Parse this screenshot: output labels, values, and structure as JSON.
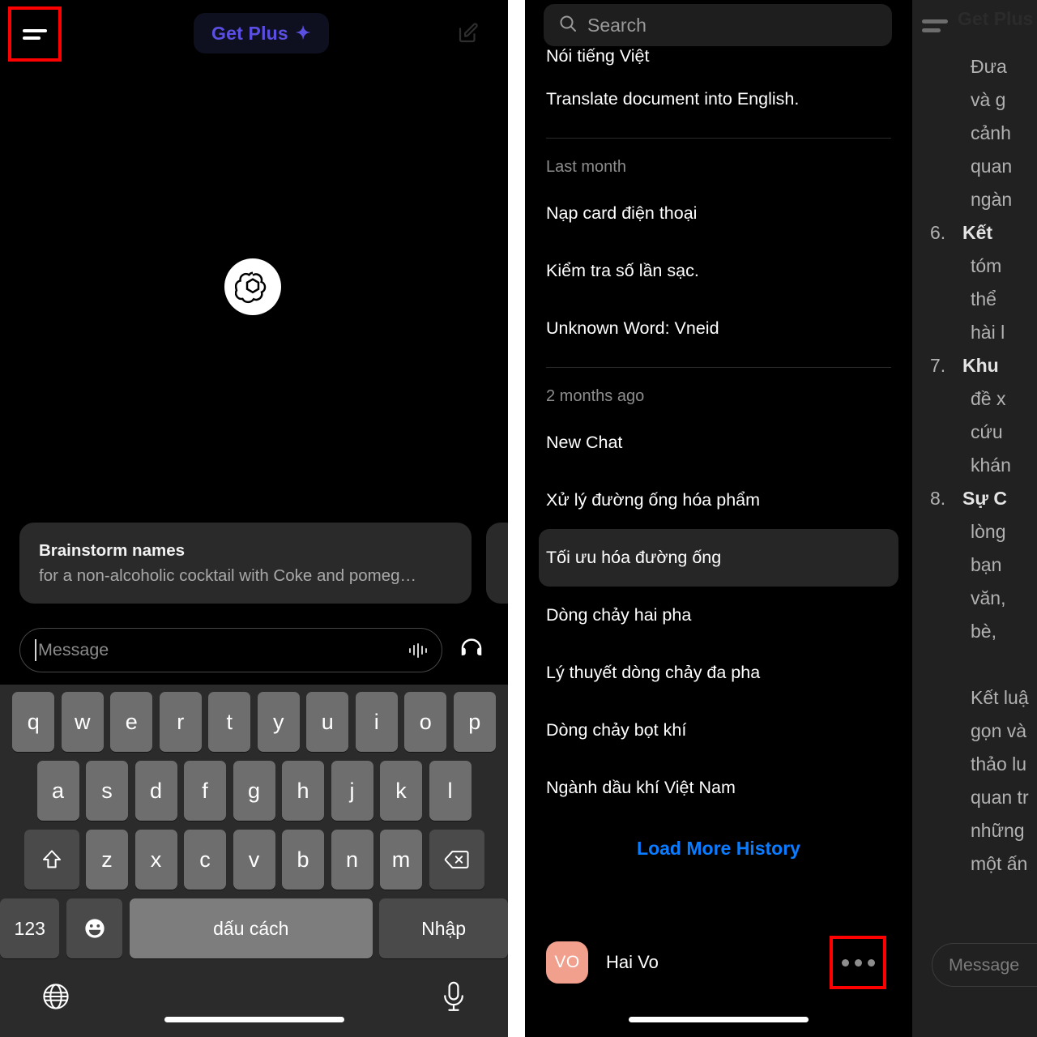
{
  "left_panel": {
    "header": {
      "menu_icon": "hamburger-menu-icon",
      "get_plus_label": "Get Plus",
      "get_plus_sparkle": "✦",
      "get_plus_text_color": "#5a4fe0",
      "get_plus_bg_color": "#0e1020",
      "new_chat_icon": "compose-edit-icon",
      "highlight_color": "#ff0000"
    },
    "brand_logo": "openai-logo",
    "suggestion_card": {
      "title": "Brainstorm names",
      "subtitle": "for a non-alcoholic cocktail with Coke and pomeg…"
    },
    "composer": {
      "placeholder": "Message",
      "waveform_icon": "audio-waveform-icon",
      "headset_icon": "headphones-icon"
    },
    "keyboard": {
      "row1": [
        "q",
        "w",
        "e",
        "r",
        "t",
        "y",
        "u",
        "i",
        "o",
        "p"
      ],
      "row2": [
        "a",
        "s",
        "d",
        "f",
        "g",
        "h",
        "j",
        "k",
        "l"
      ],
      "row3": [
        "z",
        "x",
        "c",
        "v",
        "b",
        "n",
        "m"
      ],
      "shift_icon": "shift-arrow-icon",
      "backspace_icon": "backspace-icon",
      "numbers_label": "123",
      "emoji_icon": "emoji-smiley-icon",
      "space_label": "dấu cách",
      "enter_label": "Nhập",
      "globe_icon": "globe-language-icon",
      "mic_icon": "microphone-icon"
    }
  },
  "mid_panel": {
    "search": {
      "placeholder": "Search",
      "icon": "search-icon"
    },
    "clipped_top_item": "Nói tiếng Việt",
    "top_items": [
      "Translate document into English."
    ],
    "groups": [
      {
        "label": "Last month",
        "items": [
          "Nạp card điện thoại",
          "Kiểm tra số lần sạc.",
          "Unknown Word: Vneid"
        ]
      },
      {
        "label": "2 months ago",
        "items": [
          "New Chat",
          "Xử lý đường ống hóa phẩm",
          "Tối ưu hóa đường ống",
          "Dòng chảy hai pha",
          "Lý thuyết dòng chảy đa pha",
          "Dòng chảy bọt khí",
          "Ngành dầu khí Việt Nam"
        ],
        "active_item": "Tối ưu hóa đường ống"
      }
    ],
    "load_more_label": "Load More History",
    "load_more_color": "#0a7cff",
    "profile": {
      "avatar_initials": "VO",
      "avatar_color": "#f2a08e",
      "name": "Hai Vo",
      "more_icon": "more-options-icon",
      "highlight_color": "#ff0000"
    }
  },
  "right_panel": {
    "menu_icon": "hamburger-menu-icon",
    "get_plus_label": "Get Plus",
    "lines": [
      {
        "type": "text",
        "text": "Đưa"
      },
      {
        "type": "text",
        "text": "và g"
      },
      {
        "type": "text",
        "text": "cảnh"
      },
      {
        "type": "text",
        "text": "quan"
      },
      {
        "type": "text",
        "text": "ngàn"
      },
      {
        "type": "numbered",
        "index": "6.",
        "text": "Kết"
      },
      {
        "type": "text",
        "text": "tóm"
      },
      {
        "type": "text",
        "text": "thể"
      },
      {
        "type": "text",
        "text": "hài l"
      },
      {
        "type": "numbered",
        "index": "7.",
        "text": "Khu"
      },
      {
        "type": "text",
        "text": "đề x"
      },
      {
        "type": "text",
        "text": "cứu"
      },
      {
        "type": "text",
        "text": "khán"
      },
      {
        "type": "numbered",
        "index": "8.",
        "text": "Sự C"
      },
      {
        "type": "text",
        "text": "lòng"
      },
      {
        "type": "text",
        "text": "bạn"
      },
      {
        "type": "text",
        "text": "văn,"
      },
      {
        "type": "text",
        "text": "bè, "
      },
      {
        "type": "blank",
        "text": ""
      },
      {
        "type": "text",
        "text": "Kết luậ"
      },
      {
        "type": "text",
        "text": "gọn và"
      },
      {
        "type": "text",
        "text": "thảo lu"
      },
      {
        "type": "text",
        "text": "quan tr"
      },
      {
        "type": "text",
        "text": "những"
      },
      {
        "type": "text",
        "text": "một ấn"
      }
    ],
    "composer_placeholder": "Message"
  }
}
